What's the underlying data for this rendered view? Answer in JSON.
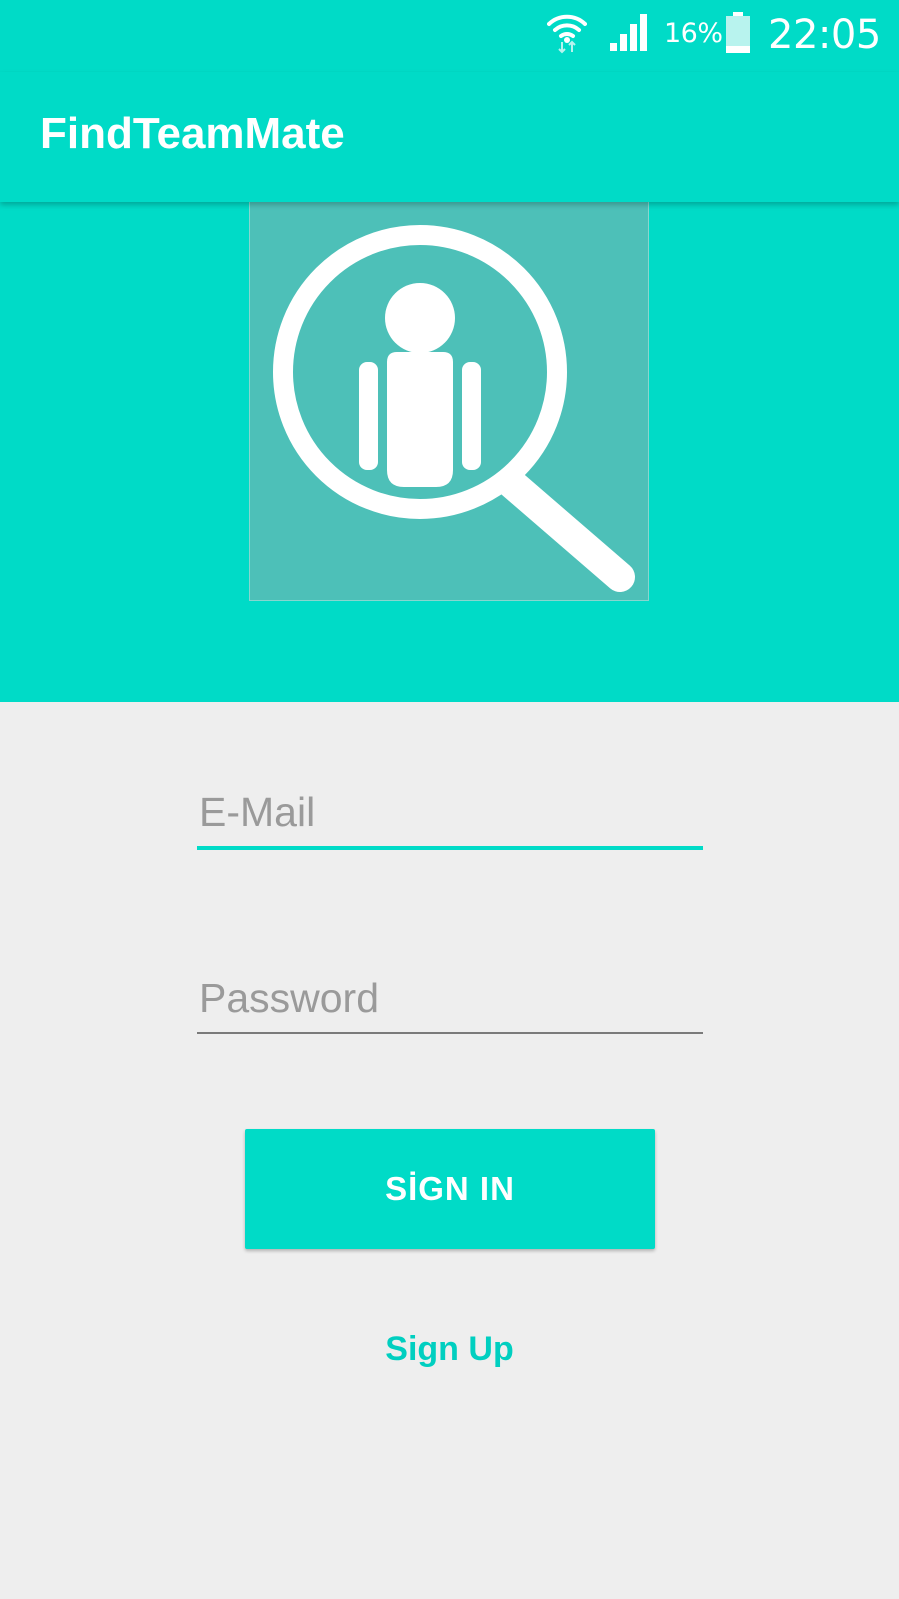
{
  "status_bar": {
    "battery_percent": "16%",
    "time": "22:05",
    "icons": [
      "wifi-icon",
      "signal-icon",
      "battery-icon"
    ]
  },
  "app_bar": {
    "title": "FindTeamMate"
  },
  "logo": {
    "icon": "magnifier-person-icon"
  },
  "form": {
    "email_placeholder": "E-Mail",
    "email_value": "",
    "password_placeholder": "Password",
    "password_value": "",
    "signin_label": "SİGN IN",
    "signup_label": "Sign Up"
  },
  "colors": {
    "accent": "#00dbc7",
    "logo_background": "#4dc0b8",
    "background": "#eeeeee",
    "placeholder": "#9a9a9a"
  }
}
